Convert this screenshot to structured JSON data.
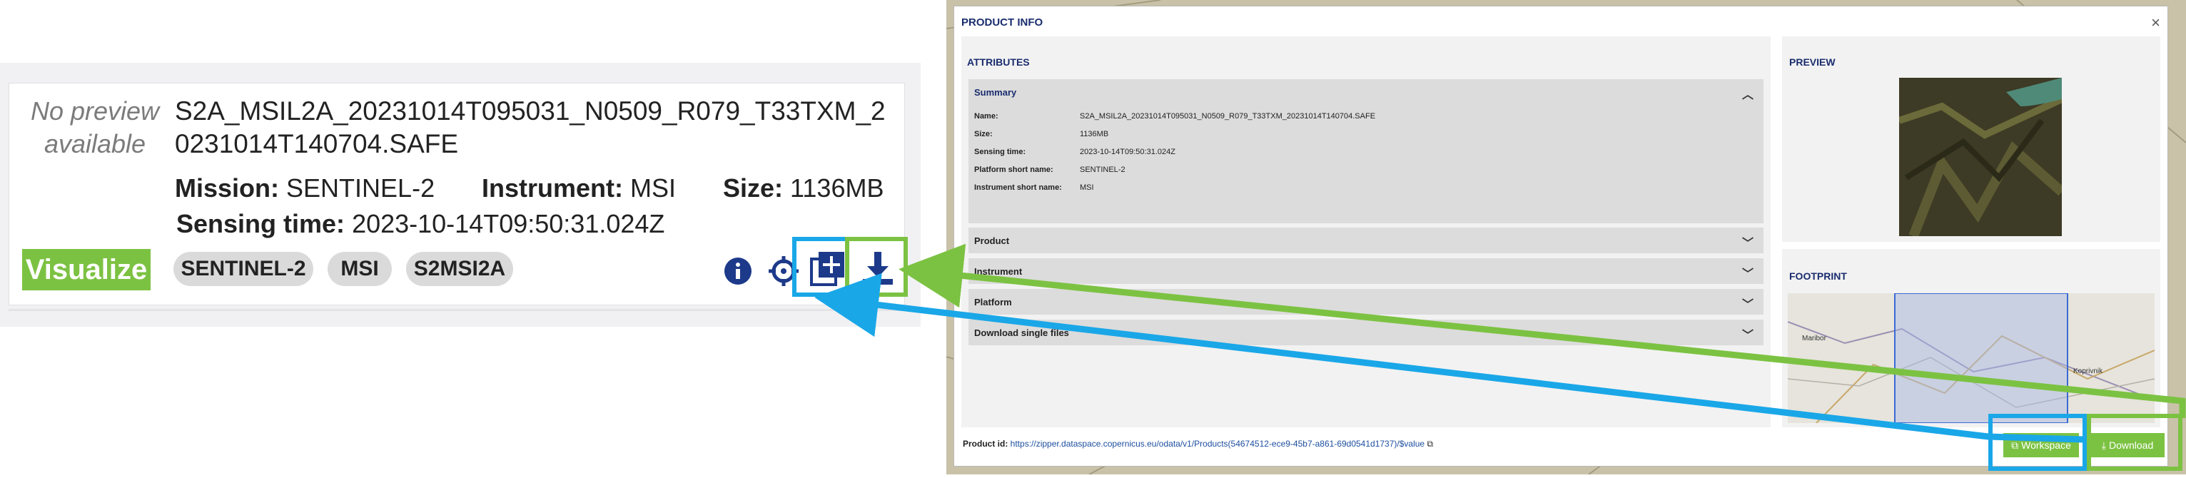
{
  "card": {
    "no_preview": "No preview available",
    "product_name": "S2A_MSIL2A_20231014T095031_N0509_R079_T33TXM_20231014T140704.SAFE",
    "mission_label": "Mission:",
    "mission_value": "SENTINEL-2",
    "instrument_label": "Instrument:",
    "instrument_value": "MSI",
    "size_label": "Size:",
    "size_value": "1136MB",
    "sensing_label": "Sensing time:",
    "sensing_value": "2023-10-14T09:50:31.024Z",
    "visualize_label": "Visualize",
    "tags": [
      "SENTINEL-2",
      "MSI",
      "S2MSI2A"
    ],
    "icons": [
      "info-icon",
      "crosshair-icon",
      "add-to-workspace-icon",
      "download-icon"
    ]
  },
  "modal": {
    "title": "PRODUCT INFO",
    "close": "×",
    "attributes_title": "ATTRIBUTES",
    "summary": {
      "header": "Summary",
      "rows": [
        {
          "label": "Name:",
          "value": "S2A_MSIL2A_20231014T095031_N0509_R079_T33TXM_20231014T140704.SAFE"
        },
        {
          "label": "Size:",
          "value": "1136MB"
        },
        {
          "label": "Sensing time:",
          "value": "2023-10-14T09:50:31.024Z"
        },
        {
          "label": "Platform short name:",
          "value": "SENTINEL-2"
        },
        {
          "label": "Instrument short name:",
          "value": "MSI"
        }
      ]
    },
    "accordions": [
      "Product",
      "Instrument",
      "Platform",
      "Download single files"
    ],
    "preview_title": "PREVIEW",
    "footprint_title": "FOOTPRINT",
    "map_labels": [
      "Maribor",
      "Koprivnik"
    ],
    "product_id_label": "Product id:",
    "product_id_url": "https://zipper.dataspace.copernicus.eu/odata/v1/Products(54674512-ece9-45b7-a861-69d0541d1737)/$value",
    "workspace_label": "Workspace",
    "download_label": "Download"
  },
  "colors": {
    "accent_green": "#7cc242",
    "highlight_blue": "#1aa7e8",
    "title_navy": "#1a2d6e"
  }
}
